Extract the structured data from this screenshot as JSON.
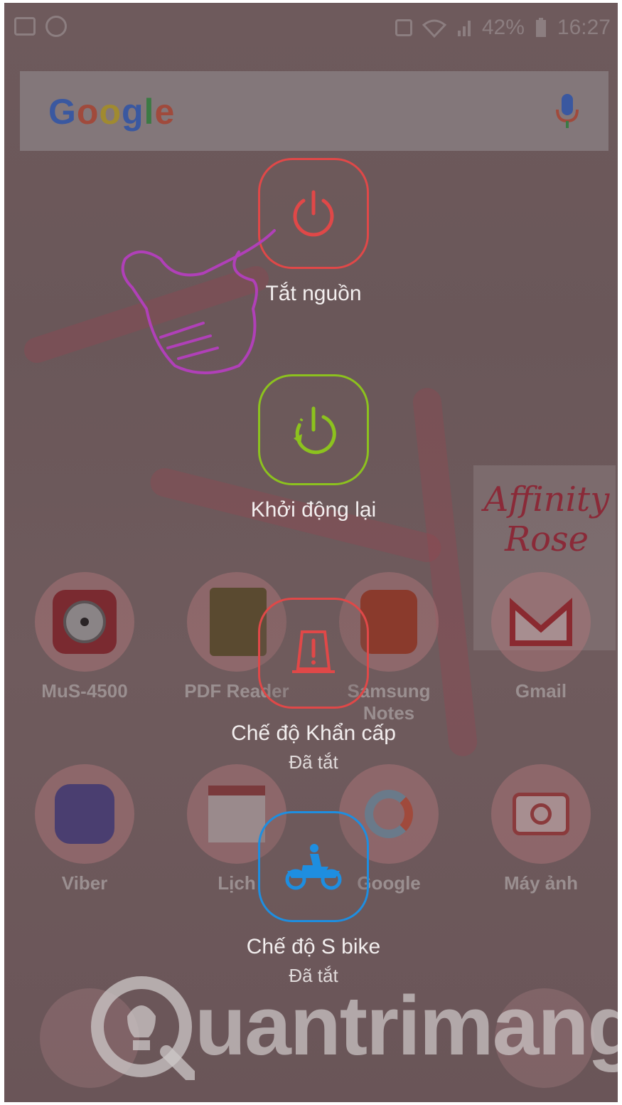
{
  "status_bar": {
    "battery": "42%",
    "time": "16:27"
  },
  "search": {
    "logo_letters": [
      "G",
      "o",
      "o",
      "g",
      "l",
      "e"
    ],
    "mic_icon": "mic-icon"
  },
  "wallpaper": {
    "script_text_line1": "Affinity",
    "script_text_line2": "Rose"
  },
  "apps_row1": [
    {
      "label": "MuS-4500",
      "icon": "camera-lens-icon"
    },
    {
      "label": "PDF Reader",
      "icon": "pdf-book-icon"
    },
    {
      "label": "Samsung Notes",
      "icon": "notes-icon"
    },
    {
      "label": "Gmail",
      "icon": "gmail-icon"
    }
  ],
  "apps_row2": [
    {
      "label": "Viber",
      "icon": "viber-icon"
    },
    {
      "label": "Lịch",
      "icon": "calendar-icon"
    },
    {
      "label": "Google",
      "icon": "google-g-icon"
    },
    {
      "label": "Máy ảnh",
      "icon": "camera-icon"
    }
  ],
  "power_menu": {
    "power_off": {
      "label": "Tắt nguồn",
      "color": "#e04848"
    },
    "restart": {
      "label": "Khởi động lại",
      "color": "#8cc21e"
    },
    "emergency": {
      "label": "Chế độ Khẩn cấp",
      "status": "Đã tắt",
      "color": "#e04848"
    },
    "sbike": {
      "label": "Chế độ S bike",
      "status": "Đã tắt",
      "color": "#1e8ee0"
    }
  },
  "watermark": {
    "text": "uantrimang"
  }
}
